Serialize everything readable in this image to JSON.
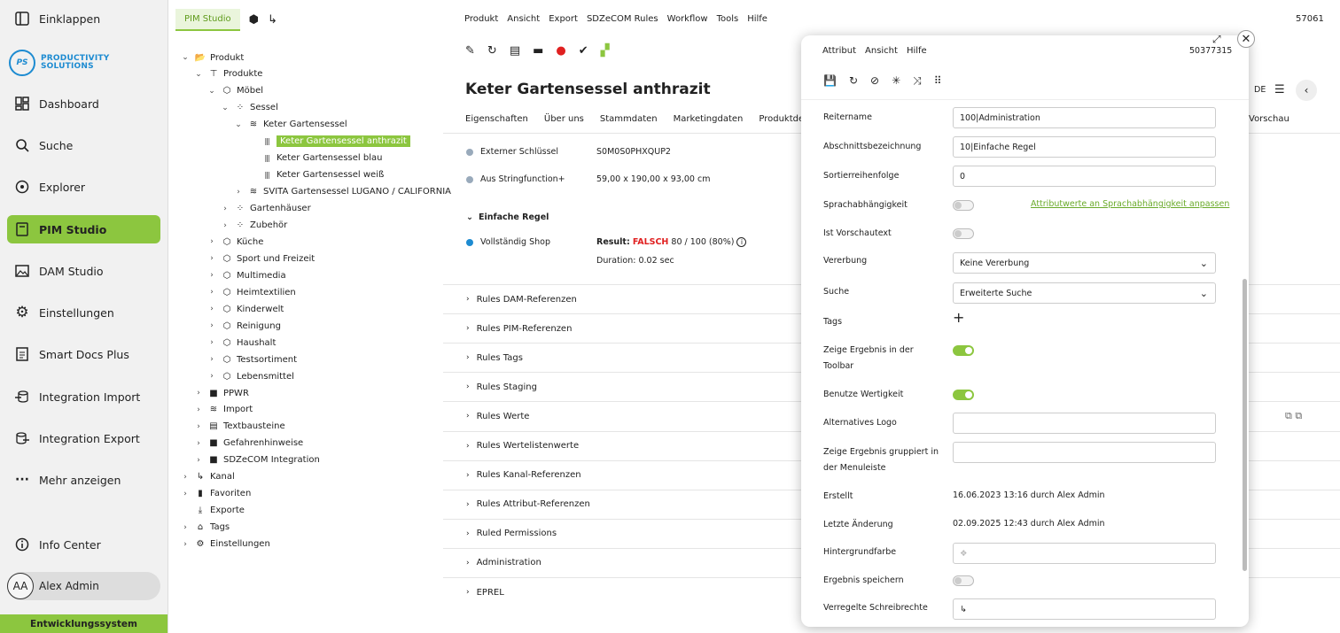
{
  "sidebar": {
    "collapse": "Einklappen",
    "logo_initials": "PS",
    "logo_line1": "PRODUCTIVITY",
    "logo_line2": "SOLUTIONS",
    "items": [
      {
        "label": "Dashboard",
        "icon": "dashboard-icon"
      },
      {
        "label": "Suche",
        "icon": "search-icon"
      },
      {
        "label": "Explorer",
        "icon": "explorer-icon"
      },
      {
        "label": "PIM Studio",
        "icon": "pim-icon"
      },
      {
        "label": "DAM Studio",
        "icon": "image-icon"
      },
      {
        "label": "Einstellungen",
        "icon": "gear-icon"
      },
      {
        "label": "Smart Docs Plus",
        "icon": "document-icon"
      },
      {
        "label": "Integration Import",
        "icon": "import-icon"
      },
      {
        "label": "Integration Export",
        "icon": "export-icon"
      },
      {
        "label": "Mehr anzeigen",
        "icon": "more-icon"
      }
    ],
    "info": "Info Center",
    "user_initials": "AA",
    "user": "Alex Admin",
    "env": "Entwicklungssystem"
  },
  "tree": {
    "tab": "PIM Studio",
    "nodes": [
      "Produkt",
      "Produkte",
      "Möbel",
      "Sessel",
      "Keter Gartensessel",
      "Keter Gartensessel anthrazit",
      "Keter Gartensessel blau",
      "Keter Gartensessel weiß",
      "SVITA Gartensessel LUGANO / CALIFORNIA",
      "Gartenhäuser",
      "Zubehör",
      "Küche",
      "Sport und Freizeit",
      "Multimedia",
      "Heimtextilien",
      "Kinderwelt",
      "Reinigung",
      "Haushalt",
      "Testsortiment",
      "Lebensmittel",
      "PPWR",
      "Import",
      "Textbausteine",
      "Gefahrenhinweise",
      "SDZeCOM Integration",
      "Kanal",
      "Favoriten",
      "Exporte",
      "Tags",
      "Einstellungen"
    ]
  },
  "main": {
    "menu": [
      "Produkt",
      "Ansicht",
      "Export",
      "SDZeCOM Rules",
      "Workflow",
      "Tools",
      "Hilfe"
    ],
    "id": "57061",
    "title": "Keter Gartensessel anthrazit",
    "lang": "DE",
    "tabs": [
      "Eigenschaften",
      "Über uns",
      "Stammdaten",
      "Marketingdaten",
      "Produktdetails"
    ],
    "tab_last": "Vorschau",
    "rows": {
      "k1": "Externer Schlüssel",
      "v1": "S0M0S0PHXQUP2",
      "k2": "Aus Stringfunction+",
      "v2": "59,00 x 190,00 x 93,00 cm"
    },
    "rule_group": "Einfache Regel",
    "rule_name": "Vollständig Shop",
    "result_label": "Result:",
    "result_value": "FALSCH",
    "result_rest": "80 / 100 (80%)",
    "duration": "Duration: 0.02 sec",
    "sections": [
      "Rules DAM-Referenzen",
      "Rules PIM-Referenzen",
      "Rules Tags",
      "Rules Staging",
      "Rules Werte",
      "Rules Wertelistenwerte",
      "Rules Kanal-Referenzen",
      "Rules Attribut-Referenzen",
      "Ruled Permissions",
      "Administration",
      "EPREL"
    ]
  },
  "modal": {
    "menu": [
      "Attribut",
      "Ansicht",
      "Hilfe"
    ],
    "id": "50377315",
    "labels": {
      "reitername": "Reitername",
      "abschnitt": "Abschnittsbezeichnung",
      "sort": "Sortierreihenfolge",
      "sprach": "Sprachabhängigkeit",
      "vorschau": "Ist Vorschautext",
      "vererbung": "Vererbung",
      "suche": "Suche",
      "tags": "Tags",
      "zeige1": "Zeige Ergebnis in der",
      "zeige2": "Toolbar",
      "wertigkeit": "Benutze Wertigkeit",
      "logo": "Alternatives Logo",
      "gruppiert1": "Zeige Ergebnis gruppiert in",
      "gruppiert2": "der Menuleiste",
      "erstellt": "Erstellt",
      "aenderung": "Letzte Änderung",
      "hintergrund": "Hintergrundfarbe",
      "speichern": "Ergebnis speichern",
      "schreib": "Verregelte Schreibrechte"
    },
    "values": {
      "reitername": "100|Administration",
      "abschnitt": "10|Einfache Regel",
      "sort": "0",
      "sprach_link": "Attributwerte an Sprachabhängigkeit anpassen",
      "vererbung": "Keine Vererbung",
      "suche": "Erweiterte Suche",
      "erstellt": "16.06.2023 13:16 durch Alex Admin",
      "aenderung": "02.09.2025 12:43 durch Alex Admin"
    }
  },
  "colors": {
    "accent": "#8cc63f",
    "fail": "#e02020",
    "link": "#6aaa2a"
  }
}
